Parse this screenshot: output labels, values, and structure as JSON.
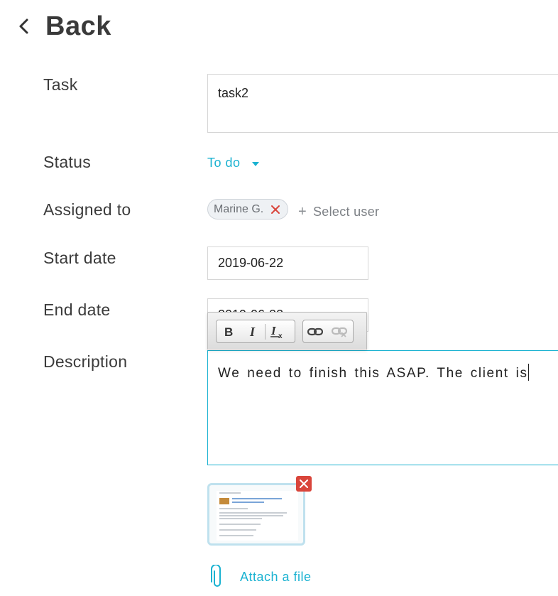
{
  "header": {
    "back_label": "Back"
  },
  "form": {
    "task": {
      "label": "Task",
      "value": "task2"
    },
    "status": {
      "label": "Status",
      "value": "To do"
    },
    "assigned": {
      "label": "Assigned to",
      "user_chip": "Marine G.",
      "select_user": "Select user"
    },
    "start_date": {
      "label": "Start date",
      "value": "2019-06-22"
    },
    "end_date": {
      "label": "End date",
      "value": "2019-06-22"
    },
    "description": {
      "label": "Description",
      "value": "We need to finish this ASAP. The client is",
      "toolbar": [
        "bold-icon",
        "italic-icon",
        "remove-format-icon",
        "link-icon",
        "unlink-icon"
      ]
    },
    "attach_label": "Attach a file"
  },
  "colors": {
    "accent": "#1ab2d1",
    "remove_red": "#d9453b"
  }
}
